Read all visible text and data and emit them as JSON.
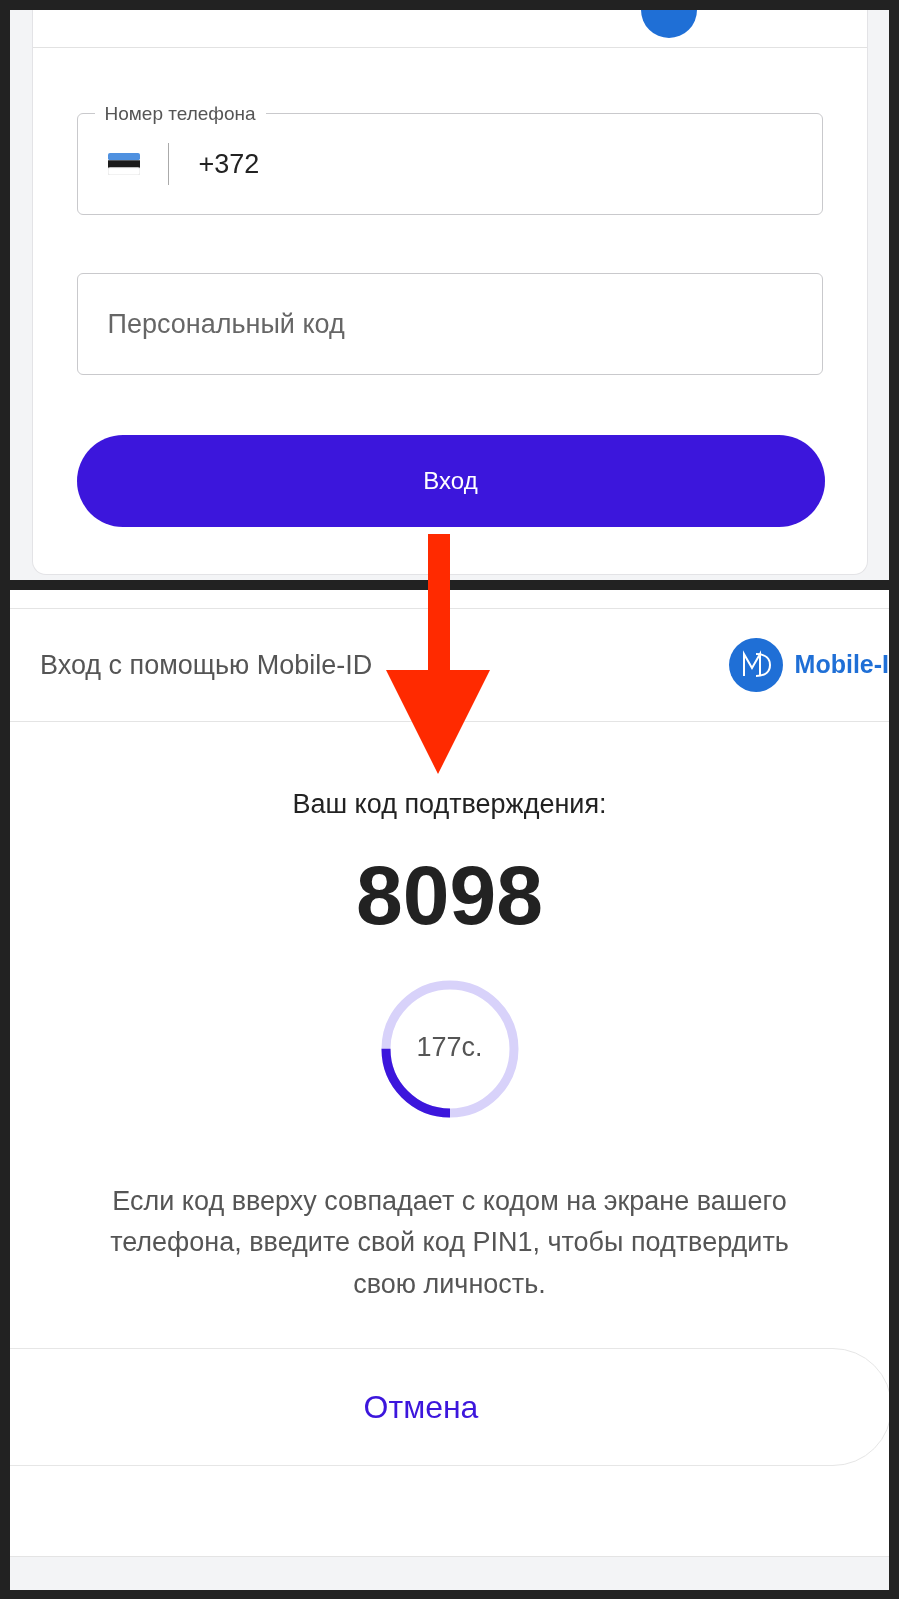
{
  "login_form": {
    "phone_field": {
      "label": "Номер телефона",
      "value": "+372"
    },
    "personal_code_field": {
      "placeholder": "Персональный код"
    },
    "login_button": "Вход"
  },
  "confirmation": {
    "header_title": "Вход с помощью Mobile-ID",
    "brand": "Mobile-I",
    "prompt": "Ваш код подтверждения:",
    "code": "8098",
    "timer": {
      "level": 0.25,
      "reading": "177с."
    },
    "instructions": "Если код вверху совпадает с кодом на экране вашего телефона, введите свой код PIN1, чтобы подтвердить свою личность.",
    "cancel_button": "Отмена"
  }
}
